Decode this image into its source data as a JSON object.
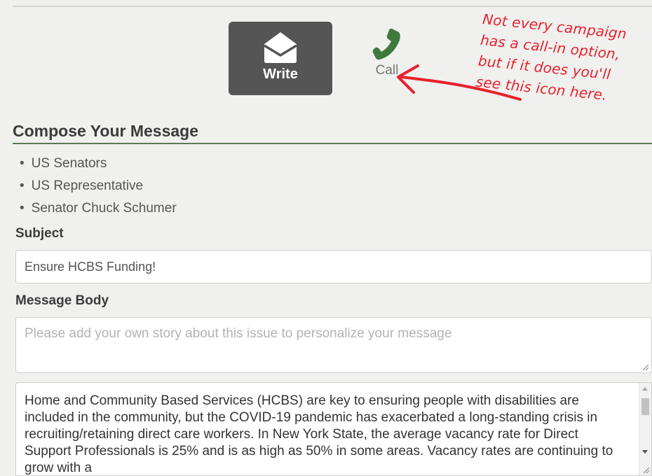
{
  "actions": {
    "write_label": "Write",
    "call_label": "Call"
  },
  "annotation": {
    "lines": [
      "Not every campaign",
      "has a call-in option,",
      "but if it does you'll",
      "see this icon here."
    ]
  },
  "compose": {
    "title": "Compose Your Message",
    "recipients": [
      "US Senators",
      "US Representative",
      "Senator Chuck Schumer"
    ]
  },
  "subject": {
    "label": "Subject",
    "value": "Ensure HCBS Funding!"
  },
  "message": {
    "label": "Message Body",
    "story_placeholder": "Please add your own story about this issue to personalize your message",
    "body_text": "Home and Community Based Services (HCBS) are key to ensuring people with disabilities are included in the community, but the COVID-19 pandemic has exacerbated a long-standing crisis in recruiting/retaining direct care workers.  In New York State, the average vacancy rate for Direct Support Professionals is 25% and is as high as 50% in some areas.  Vacancy rates are continuing to grow with a"
  },
  "colors": {
    "write_button_bg": "#555555",
    "phone_icon": "#3f7a3c",
    "annotation": "#e8212b",
    "section_rule": "#5a7a52"
  }
}
